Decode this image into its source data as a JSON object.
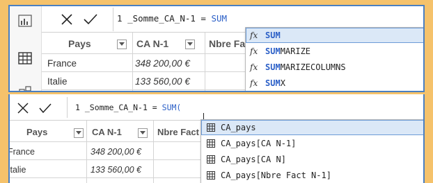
{
  "top_panel": {
    "formula_line_number": "1",
    "formula_prefix": "_Somme_CA_N-1 = ",
    "formula_typed": "SUM",
    "columns": [
      "Pays",
      "CA N-1",
      "Nbre Fact"
    ],
    "rows": [
      {
        "pays": "France",
        "ca": "348 200,00 €"
      },
      {
        "pays": "Italie",
        "ca": "133 560,00 €"
      }
    ],
    "suggestions": [
      {
        "fx": "fx",
        "match": "SUM",
        "rest": "",
        "selected": true
      },
      {
        "fx": "fx",
        "match": "SUM",
        "rest": "MARIZE",
        "selected": false
      },
      {
        "fx": "fx",
        "match": "SUM",
        "rest": "MARIZECOLUMNS",
        "selected": false
      },
      {
        "fx": "fx",
        "match": "SUM",
        "rest": "X",
        "selected": false
      }
    ]
  },
  "bottom_panel": {
    "formula_line_number": "1",
    "formula_prefix": "_Somme_CA_N-1 = ",
    "formula_typed": "SUM(",
    "columns": [
      "Pays",
      "CA N-1",
      "Nbre Fact"
    ],
    "rows": [
      {
        "pays": "France",
        "ca": "348 200,00 €"
      },
      {
        "pays": "Italie",
        "ca": "133 560,00 €"
      }
    ],
    "suggestions": [
      {
        "label": "CA_pays",
        "selected": true
      },
      {
        "label": "CA_pays[CA N-1]",
        "selected": false
      },
      {
        "label": "CA_pays[CA N]",
        "selected": false
      },
      {
        "label": "CA_pays[Nbre Fact N-1]",
        "selected": false
      }
    ]
  },
  "colors": {
    "background": "#f5c26b",
    "panel_border": "#4a7fc1",
    "keyword": "#2b5fc7",
    "selected_bg": "#dbe8f7"
  },
  "icons": [
    "report-view-icon",
    "table-view-icon",
    "model-view-icon",
    "cancel-icon",
    "commit-icon",
    "filter-dropdown-icon",
    "function-icon",
    "table-icon"
  ]
}
